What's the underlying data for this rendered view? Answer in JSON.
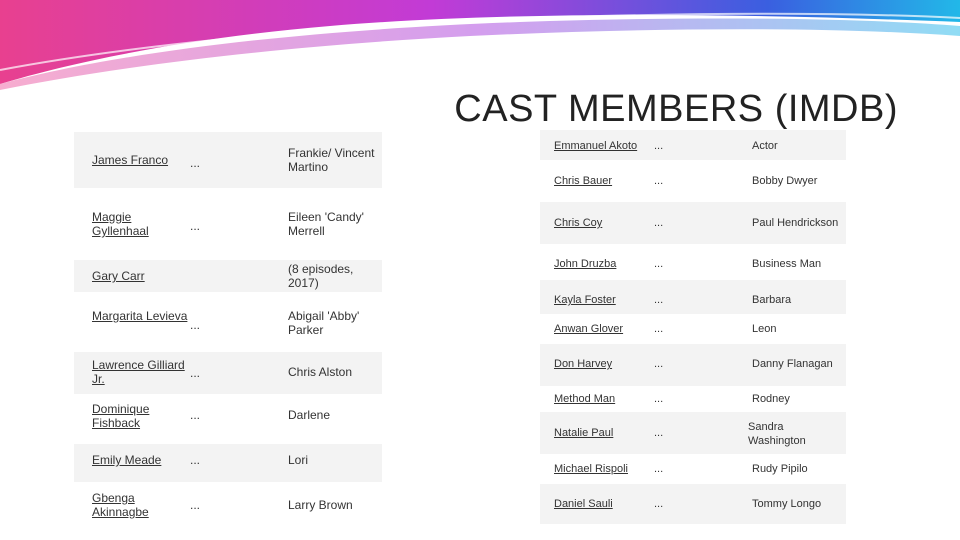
{
  "title": "CAST MEMBERS (IMDB)",
  "left_table": {
    "rows": [
      {
        "name": "James Franco",
        "dots": "...",
        "role": "Frankie/ Vincent Martino"
      },
      {
        "name": "Maggie Gyllenhaal",
        "dots": "...",
        "role": "Eileen 'Candy' Merrell"
      },
      {
        "name": "Gary Carr",
        "dots": "",
        "role": "(8 episodes, 2017)"
      },
      {
        "name": "Margarita Levieva",
        "dots": "...",
        "role": "Abigail 'Abby' Parker"
      },
      {
        "name": "Lawrence Gilliard Jr.",
        "dots": "...",
        "role": "Chris Alston"
      },
      {
        "name": "Dominique Fishback",
        "dots": "...",
        "role": "Darlene"
      },
      {
        "name": "Emily Meade",
        "dots": "...",
        "role": "Lori"
      },
      {
        "name": "Gbenga Akinnagbe",
        "dots": "...",
        "role": "Larry Brown"
      }
    ]
  },
  "right_table": {
    "rows": [
      {
        "name": "Emmanuel Akoto",
        "dots": "...",
        "role": "Actor"
      },
      {
        "name": "Chris Bauer",
        "dots": "...",
        "role": "Bobby Dwyer"
      },
      {
        "name": "Chris Coy",
        "dots": "...",
        "role": "Paul Hendrickson"
      },
      {
        "name": "John Druzba",
        "dots": "...",
        "role": "Business Man"
      },
      {
        "name": "Kayla Foster",
        "dots": "...",
        "role": "Barbara"
      },
      {
        "name": "Anwan Glover",
        "dots": "...",
        "role": "Leon"
      },
      {
        "name": "Don Harvey",
        "dots": "...",
        "role": "Danny Flanagan"
      },
      {
        "name": "Method Man",
        "dots": "...",
        "role": "Rodney"
      },
      {
        "name": "Natalie Paul",
        "dots": "...",
        "role": "Sandra Washington"
      },
      {
        "name": "Michael Rispoli",
        "dots": "...",
        "role": "Rudy Pipilo"
      },
      {
        "name": "Daniel Sauli",
        "dots": "...",
        "role": "Tommy Longo"
      }
    ]
  }
}
